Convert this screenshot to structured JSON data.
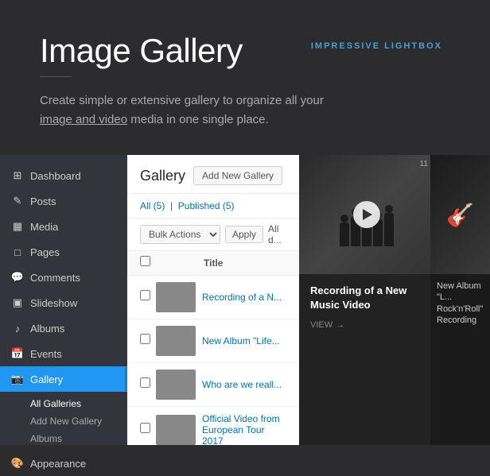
{
  "hero": {
    "title": "Image Gallery",
    "tag": "IMPRESSIVE LIGHTBOX",
    "subtitle": "Create simple or extensive gallery to organize all your image and video media in one single place.",
    "subtitle_link": "image and video"
  },
  "sidebar": {
    "items": [
      {
        "id": "dashboard",
        "label": "Dashboard",
        "icon": "⊞"
      },
      {
        "id": "posts",
        "label": "Posts",
        "icon": "✎"
      },
      {
        "id": "media",
        "label": "Media",
        "icon": "🖼"
      },
      {
        "id": "pages",
        "label": "Pages",
        "icon": "📄"
      },
      {
        "id": "comments",
        "label": "Comments",
        "icon": "💬"
      },
      {
        "id": "slideshow",
        "label": "Slideshow",
        "icon": "🎞"
      },
      {
        "id": "albums",
        "label": "Albums",
        "icon": "🎵"
      },
      {
        "id": "events",
        "label": "Events",
        "icon": "📅"
      },
      {
        "id": "gallery",
        "label": "Gallery",
        "icon": "📷",
        "active": true
      }
    ],
    "sub_items": [
      {
        "label": "All Galleries",
        "active": true
      },
      {
        "label": "Add New Gallery"
      },
      {
        "label": "Albums"
      }
    ],
    "appearance": {
      "label": "Appearance",
      "icon": "🎨"
    }
  },
  "gallery_panel": {
    "title": "Gallery",
    "add_new_label": "Add New Gallery",
    "filter": {
      "all_label": "All",
      "all_count": "5",
      "published_label": "Published",
      "published_count": "5",
      "separator": "|"
    },
    "bulk_actions": {
      "label": "Bulk Actions",
      "apply": "Apply",
      "all_dates": "All d..."
    },
    "table_header": {
      "title": "Title"
    },
    "rows": [
      {
        "id": 1,
        "title": "Recording of a N...",
        "thumb_class": "thumb-1"
      },
      {
        "id": 2,
        "title": "New Album \"Life...",
        "thumb_class": "thumb-2"
      },
      {
        "id": 3,
        "title": "Who are we reall...",
        "thumb_class": "thumb-3"
      },
      {
        "id": 4,
        "title": "Official Video from European Tour 2017",
        "thumb_class": "thumb-4"
      }
    ]
  },
  "featured_card": {
    "number": "11",
    "title": "Recording of a New Music Video",
    "view_label": "VIEW",
    "view_arrow": "→"
  },
  "second_card": {
    "title": "New Album \"L... Rock'n'Roll\" Recording"
  }
}
